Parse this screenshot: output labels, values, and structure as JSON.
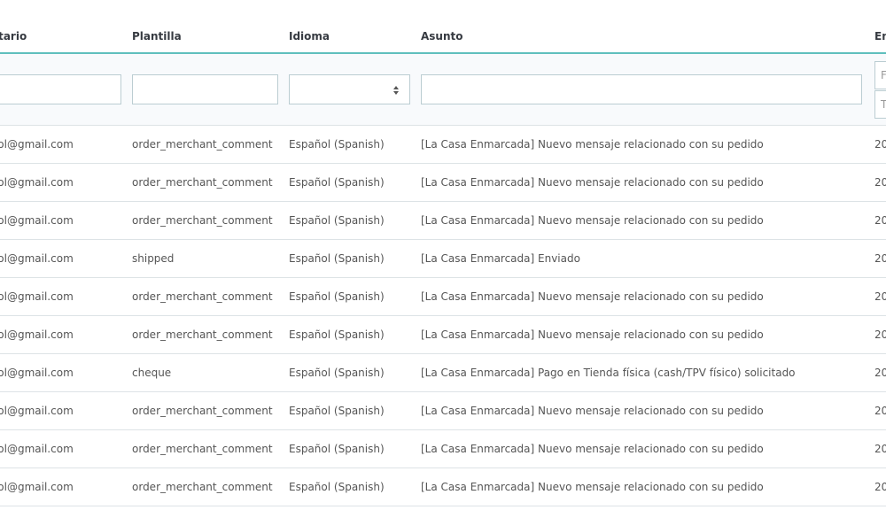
{
  "headers": {
    "recipient": "atario",
    "template": "Plantilla",
    "language": "Idioma",
    "subject": "Asunto",
    "sent": "En"
  },
  "filters": {
    "date_from_placeholder": "F",
    "date_to_placeholder": "T"
  },
  "rows": [
    {
      "recipient": "mpol@gmail.com",
      "template": "order_merchant_comment",
      "language": "Español (Spanish)",
      "subject": "[La Casa Enmarcada] Nuevo mensaje relacionado con su pedido",
      "sent": "20"
    },
    {
      "recipient": "mpol@gmail.com",
      "template": "order_merchant_comment",
      "language": "Español (Spanish)",
      "subject": "[La Casa Enmarcada] Nuevo mensaje relacionado con su pedido",
      "sent": "20"
    },
    {
      "recipient": "mpol@gmail.com",
      "template": "order_merchant_comment",
      "language": "Español (Spanish)",
      "subject": "[La Casa Enmarcada] Nuevo mensaje relacionado con su pedido",
      "sent": "20"
    },
    {
      "recipient": "mpol@gmail.com",
      "template": "shipped",
      "language": "Español (Spanish)",
      "subject": "[La Casa Enmarcada] Enviado",
      "sent": "20"
    },
    {
      "recipient": "mpol@gmail.com",
      "template": "order_merchant_comment",
      "language": "Español (Spanish)",
      "subject": "[La Casa Enmarcada] Nuevo mensaje relacionado con su pedido",
      "sent": "20"
    },
    {
      "recipient": "mpol@gmail.com",
      "template": "order_merchant_comment",
      "language": "Español (Spanish)",
      "subject": "[La Casa Enmarcada] Nuevo mensaje relacionado con su pedido",
      "sent": "20"
    },
    {
      "recipient": "mpol@gmail.com",
      "template": "cheque",
      "language": "Español (Spanish)",
      "subject": "[La Casa Enmarcada] Pago en Tienda física (cash/TPV físico) solicitado",
      "sent": "20"
    },
    {
      "recipient": "mpol@gmail.com",
      "template": "order_merchant_comment",
      "language": "Español (Spanish)",
      "subject": "[La Casa Enmarcada] Nuevo mensaje relacionado con su pedido",
      "sent": "20"
    },
    {
      "recipient": "mpol@gmail.com",
      "template": "order_merchant_comment",
      "language": "Español (Spanish)",
      "subject": "[La Casa Enmarcada] Nuevo mensaje relacionado con su pedido",
      "sent": "20"
    },
    {
      "recipient": "mpol@gmail.com",
      "template": "order_merchant_comment",
      "language": "Español (Spanish)",
      "subject": "[La Casa Enmarcada] Nuevo mensaje relacionado con su pedido",
      "sent": "20"
    }
  ]
}
